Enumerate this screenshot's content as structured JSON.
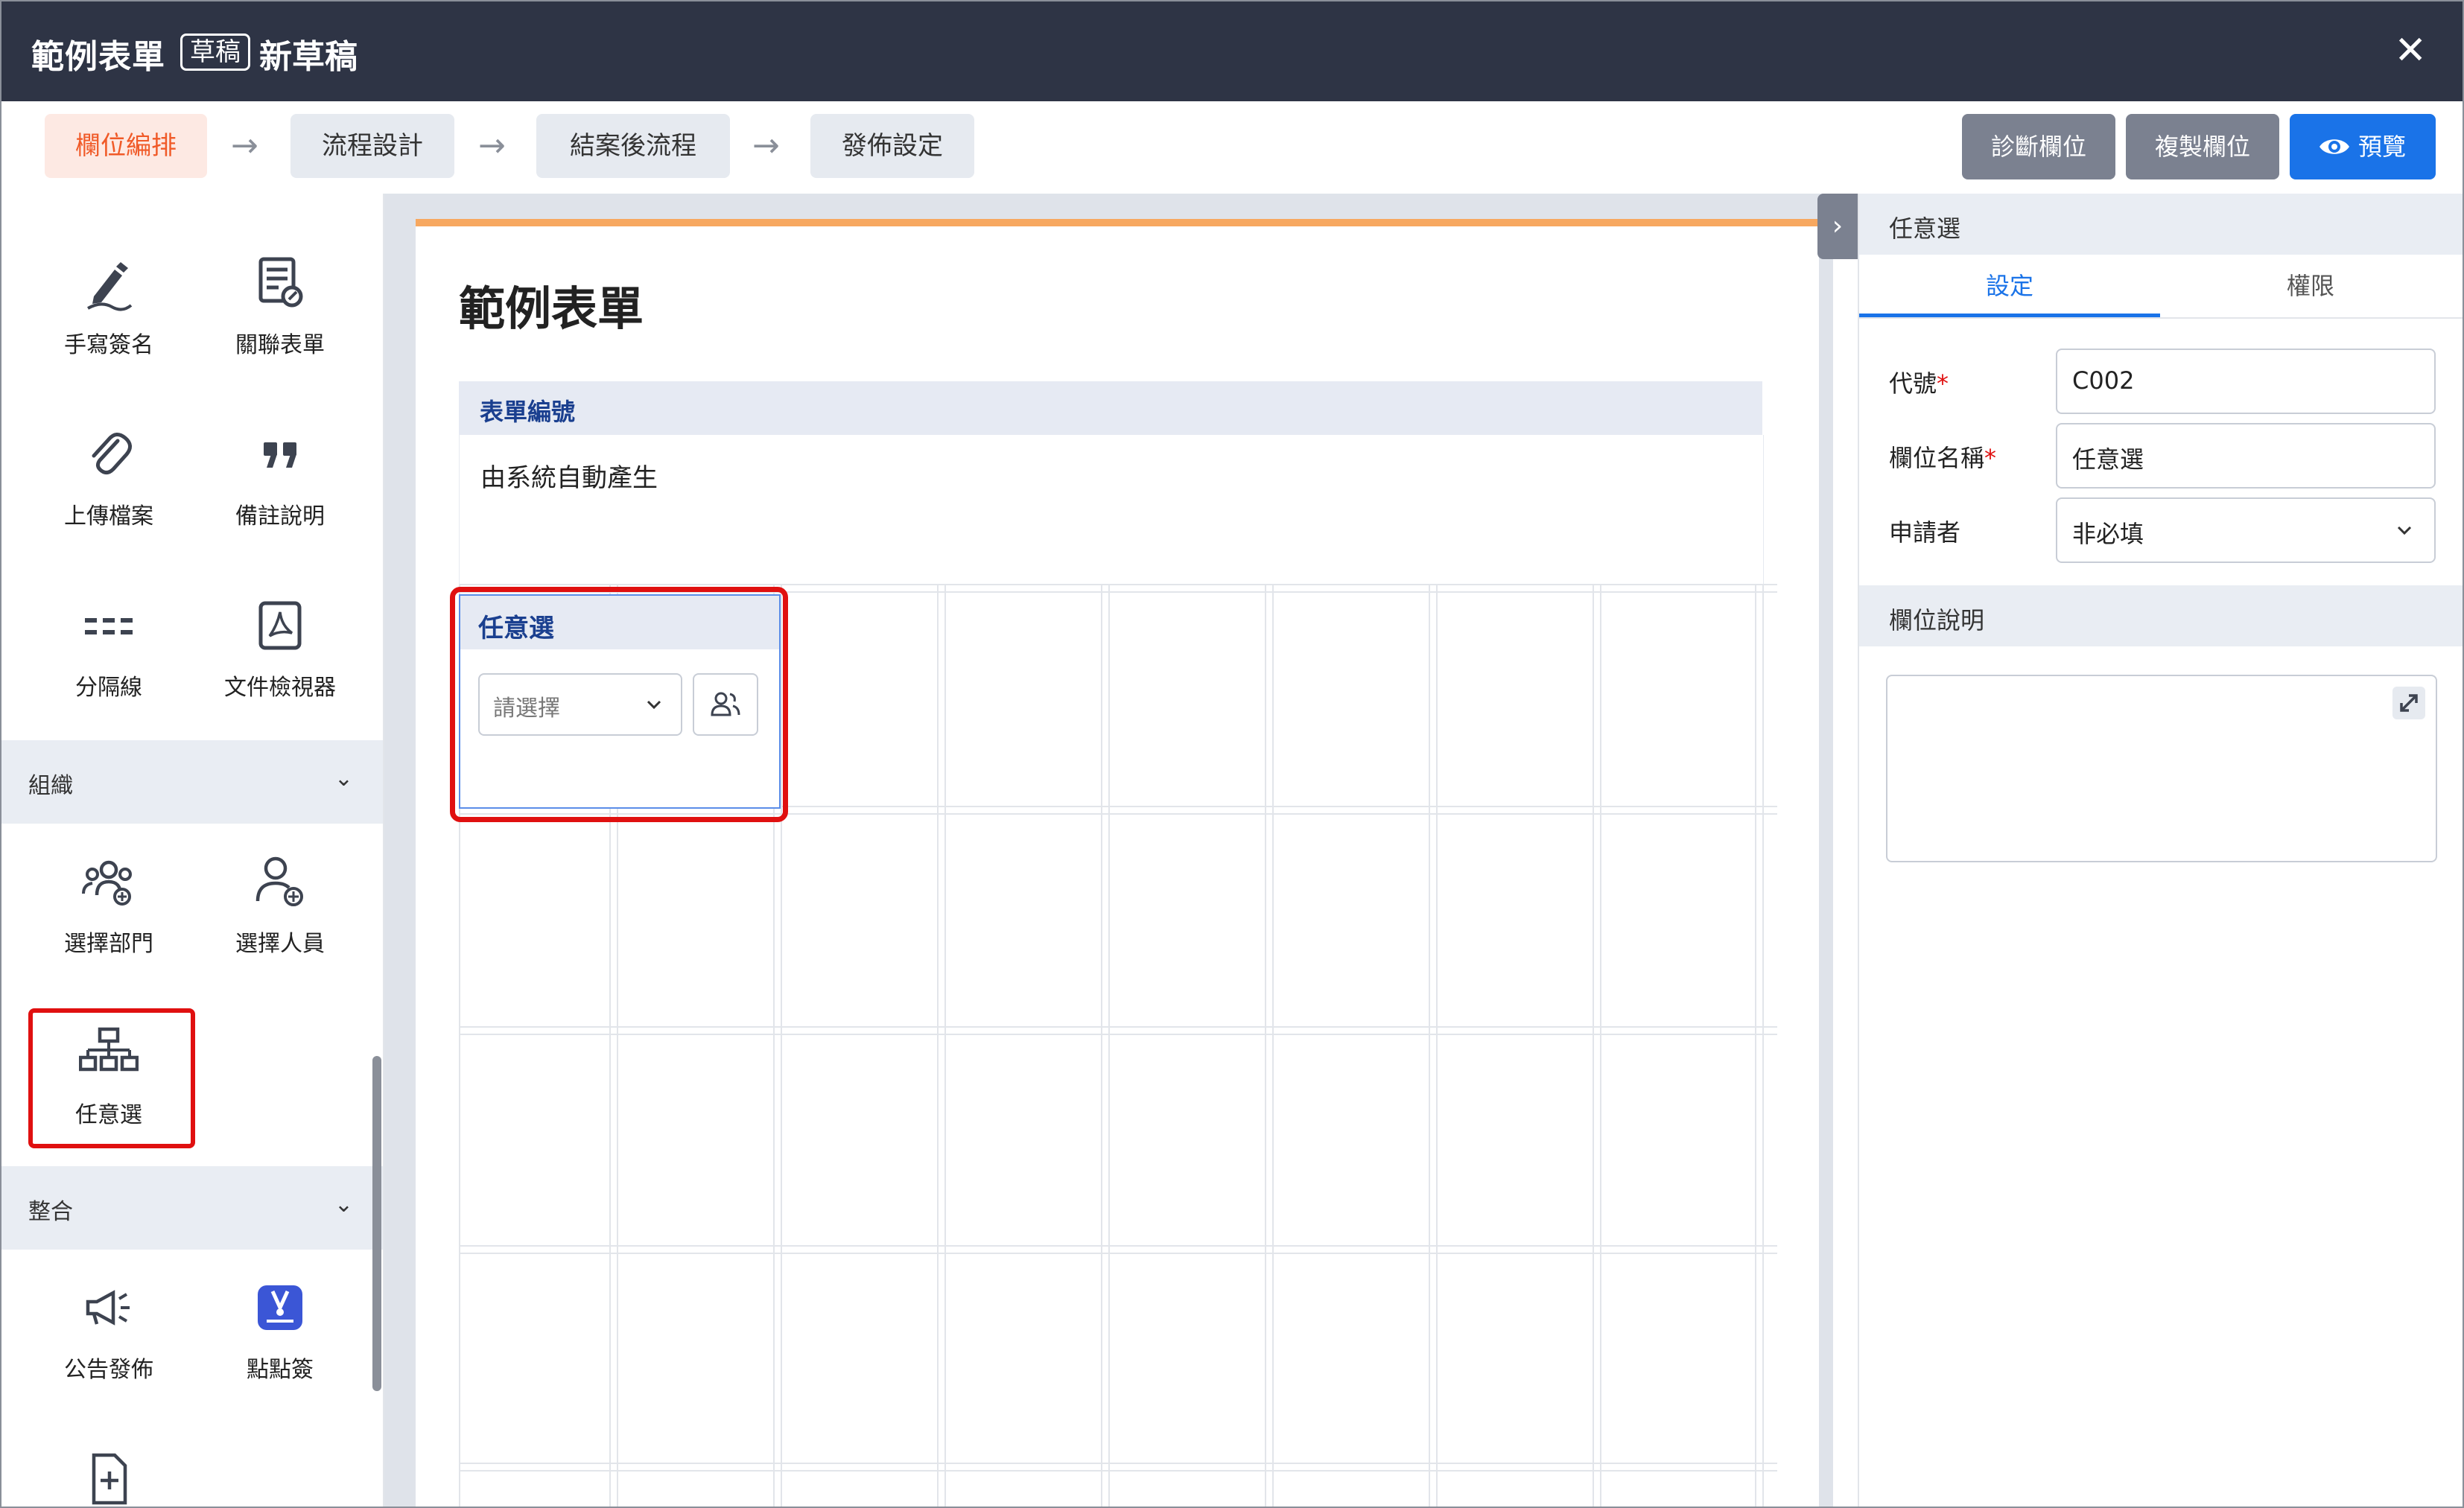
{
  "window": {
    "title": "範例表單",
    "badge": "草稿",
    "subtitle": "新草稿",
    "close_label": "✕"
  },
  "steps": [
    {
      "label": "欄位編排",
      "active": true
    },
    {
      "label": "流程設計",
      "active": false
    },
    {
      "label": "結案後流程",
      "active": false
    },
    {
      "label": "發佈設定",
      "active": false
    }
  ],
  "step_arrow": "→",
  "toolbar_buttons": {
    "diagnose": "診斷欄位",
    "copy": "複製欄位",
    "preview": "預覽"
  },
  "sidebar": {
    "tools_top": [
      {
        "label": "手寫簽名",
        "icon": "pen-signature-icon"
      },
      {
        "label": "關聯表單",
        "icon": "linked-form-icon"
      },
      {
        "label": "上傳檔案",
        "icon": "paperclip-icon"
      },
      {
        "label": "備註說明",
        "icon": "quote-icon"
      },
      {
        "label": "分隔線",
        "icon": "divider-icon"
      },
      {
        "label": "文件檢視器",
        "icon": "pdf-viewer-icon"
      }
    ],
    "section_org": {
      "label": "組織",
      "chevron": "⌄"
    },
    "tools_org": [
      {
        "label": "選擇部門",
        "icon": "department-icon"
      },
      {
        "label": "選擇人員",
        "icon": "person-add-icon"
      },
      {
        "label": "任意選",
        "icon": "org-tree-icon"
      }
    ],
    "section_integrate": {
      "label": "整合",
      "chevron": "⌄"
    },
    "tools_integrate": [
      {
        "label": "公告發佈",
        "icon": "megaphone-icon"
      },
      {
        "label": "點點簽",
        "icon": "app-logo-icon"
      }
    ]
  },
  "canvas": {
    "form_title": "範例表單",
    "form_number_label": "表單編號",
    "form_number_value": "由系統自動產生",
    "field": {
      "label": "任意選",
      "placeholder": "請選擇"
    }
  },
  "panel": {
    "header": "任意選",
    "tabs": [
      "設定",
      "權限"
    ],
    "active_tab": 0,
    "code_label": "代號",
    "code_value": "C002",
    "name_label": "欄位名稱",
    "name_value": "任意選",
    "applicant_label": "申請者",
    "applicant_value": "非必填",
    "required_mark": "*",
    "desc_section": "欄位說明",
    "collapse_glyph": "›"
  },
  "colors": {
    "titlebar": "#2e3445",
    "accent_blue": "#1a73e8",
    "active_step": "#f05a28",
    "highlight_red": "#e01010",
    "paper_top": "#f7a860"
  }
}
